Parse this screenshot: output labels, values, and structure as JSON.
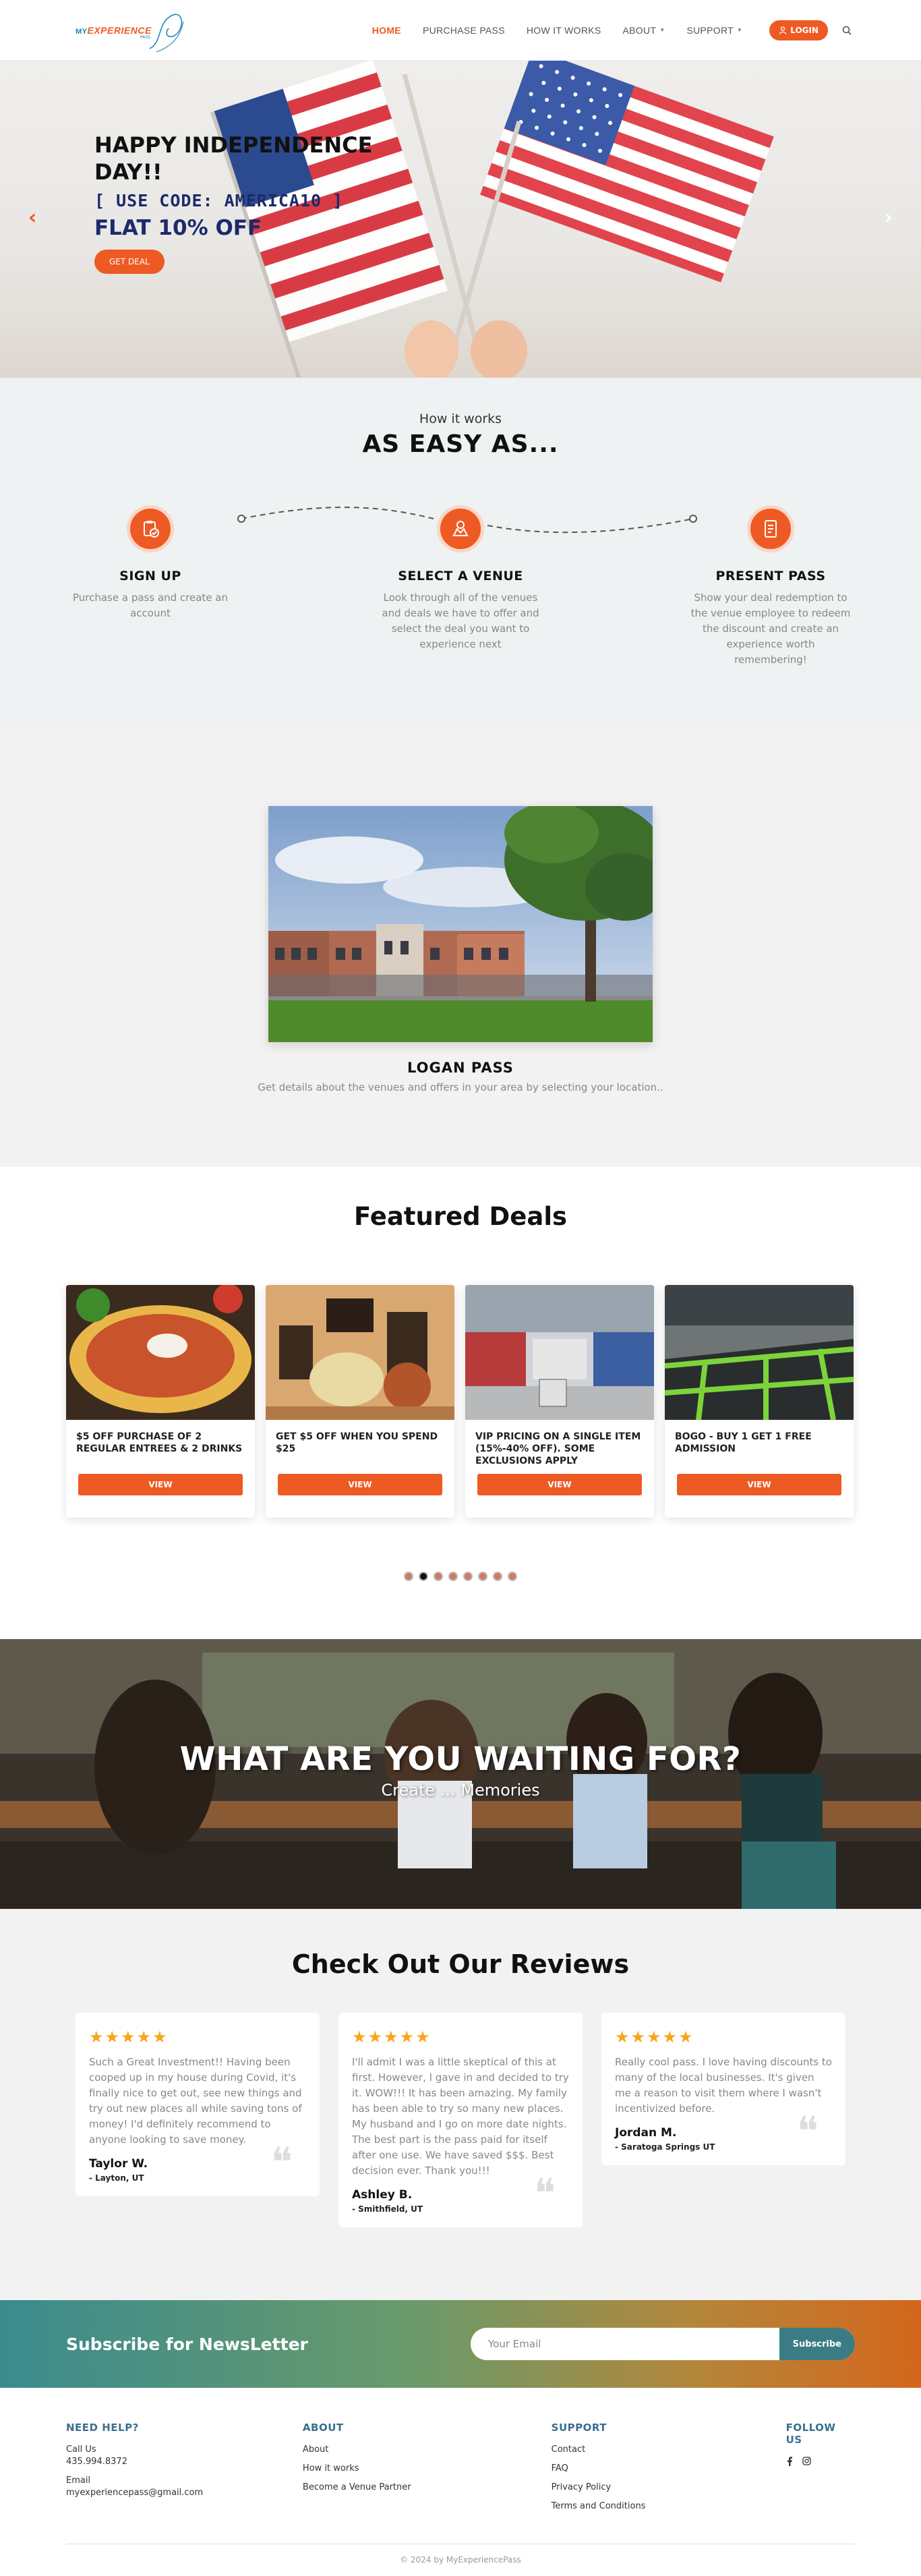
{
  "header": {
    "logo": {
      "my": "MY",
      "experience": "EXPERIENCE",
      "sub": "PASS"
    },
    "nav": [
      {
        "label": "HOME",
        "active": true,
        "dropdown": false
      },
      {
        "label": "PURCHASE PASS",
        "active": false,
        "dropdown": false
      },
      {
        "label": "HOW IT WORKS",
        "active": false,
        "dropdown": false
      },
      {
        "label": "ABOUT",
        "active": false,
        "dropdown": true
      },
      {
        "label": "SUPPORT",
        "active": false,
        "dropdown": true
      }
    ],
    "login_label": "LOGIN"
  },
  "hero": {
    "title": "HAPPY INDEPENDENCE DAY!!",
    "code": "[ USE CODE: AMERICA10 ]",
    "offer": "FLAT 10% OFF",
    "button": "GET DEAL",
    "prev_arrow": "‹",
    "next_arrow": "›"
  },
  "how": {
    "subtitle": "How it works",
    "title": "AS EASY AS...",
    "steps": [
      {
        "title": "SIGN UP",
        "text": "Purchase a pass and create an account",
        "icon": "clipboard-check-icon"
      },
      {
        "title": "SELECT A VENUE",
        "text": "Look through all of the venues and deals we have to offer and select the deal you want to experience next",
        "icon": "venue-icon"
      },
      {
        "title": "PRESENT PASS",
        "text": "Show your deal redemption to the venue employee to redeem the discount and create an experience worth remembering!",
        "icon": "pass-icon"
      }
    ]
  },
  "location": {
    "name": "LOGAN PASS",
    "description": "Get details about the venues and offers in your area by selecting your location.."
  },
  "featured": {
    "title": "Featured Deals",
    "deals": [
      {
        "title": "$5 OFF PURCHASE OF 2 REGULAR ENTREES & 2 DRINKS",
        "button": "VIEW"
      },
      {
        "title": "GET $5 OFF WHEN YOU SPEND $25",
        "button": "VIEW"
      },
      {
        "title": "VIP PRICING ON A SINGLE ITEM (15%-40% OFF). SOME EXCLUSIONS APPLY",
        "button": "VIEW"
      },
      {
        "title": "BOGO - BUY 1 GET 1 FREE ADMISSION",
        "button": "VIEW"
      }
    ],
    "dot_count": 8,
    "active_dot": 1
  },
  "banner": {
    "title": "WHAT ARE YOU WAITING FOR?",
    "subtitle": "Create ... Memories"
  },
  "reviews": {
    "title": "Check Out Our Reviews",
    "items": [
      {
        "stars": "★★★★★",
        "text": "Such a Great Investment!! Having been cooped up in my house during Covid, it's finally nice to get out, see new things and try out new places all while saving tons of money! I'd definitely recommend to anyone looking to save money.",
        "name": "Taylor W.",
        "location": "- Layton, UT"
      },
      {
        "stars": "★★★★★",
        "text": "I'll admit I was a little skeptical of this at first. However, I gave in and decided to try it. WOW!!! It has been amazing. My family has been able to try so many new places. My husband and I go on more date nights. The best part is the pass paid for itself after one use. We have saved $$$. Best decision ever. Thank you!!!",
        "name": "Ashley B.",
        "location": "- Smithfield, UT"
      },
      {
        "stars": "★★★★★",
        "text": "Really cool pass. I love having discounts to many of the local businesses. It's given me a reason to visit them where I wasn't incentivized before.",
        "name": "Jordan M.",
        "location": "- Saratoga Springs UT"
      }
    ]
  },
  "newsletter": {
    "title": "Subscribe for NewsLetter",
    "placeholder": "Your Email",
    "button": "Subscribe"
  },
  "footer": {
    "help": {
      "heading": "NEED HELP?",
      "call_label": "Call Us",
      "phone": "435.994.8372",
      "email_label": "Email",
      "email": "myexperiencepass@gmail.com"
    },
    "about": {
      "heading": "ABOUT",
      "links": [
        "About",
        "How it works",
        "Become a Venue Partner"
      ]
    },
    "support": {
      "heading": "SUPPORT",
      "links": [
        "Contact",
        "FAQ",
        "Privacy Policy",
        "Terms and Conditions"
      ]
    },
    "follow": {
      "heading": "FOLLOW US",
      "icons": [
        "facebook-icon",
        "instagram-icon"
      ]
    },
    "copyright": "© 2024 by MyExperiencePass"
  },
  "colors": {
    "accent": "#ee5a24",
    "navy": "#1c2a6b",
    "footer_heading": "#3b6f8e"
  }
}
